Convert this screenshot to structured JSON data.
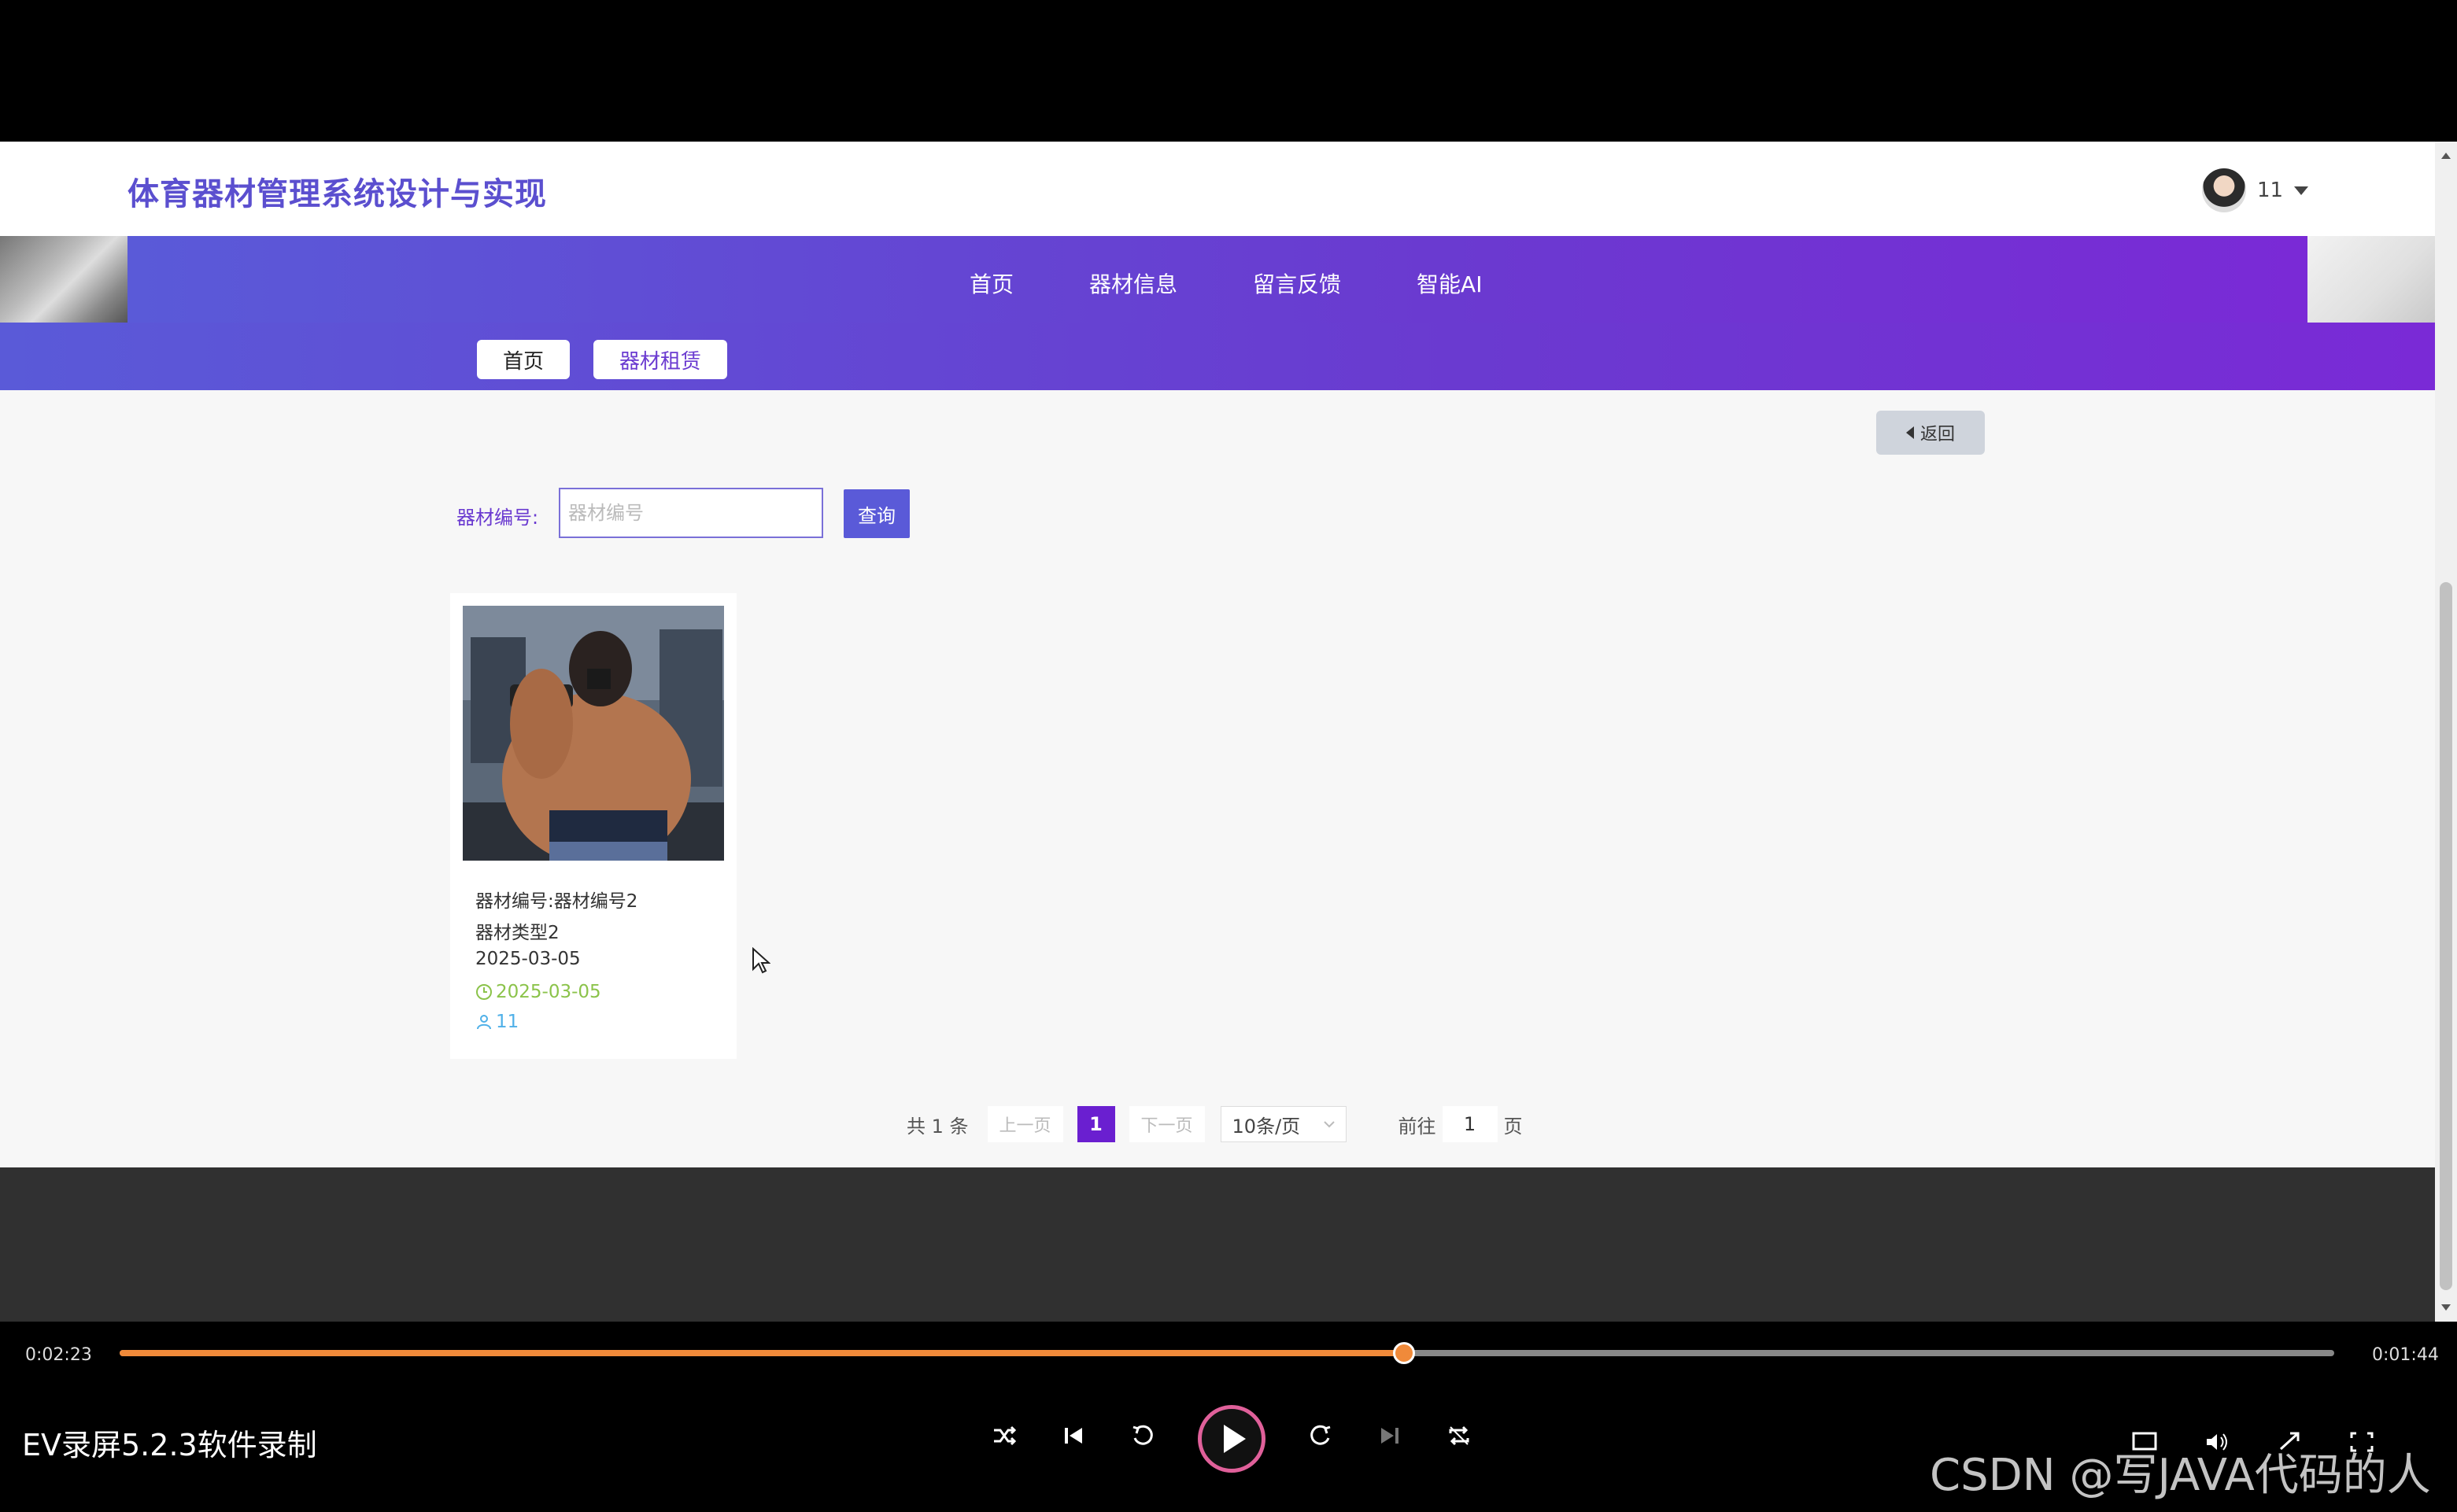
{
  "site": {
    "title": "体育器材管理系统设计与实现"
  },
  "user": {
    "name": "11"
  },
  "nav": {
    "items": [
      "首页",
      "器材信息",
      "留言反馈",
      "智能AI"
    ]
  },
  "breadcrumb": {
    "home": "首页",
    "current": "器材租赁"
  },
  "back": {
    "label": "返回"
  },
  "search": {
    "label": "器材编号:",
    "placeholder": "器材编号",
    "button": "查询"
  },
  "cards": [
    {
      "code": "器材编号:器材编号2",
      "type": "器材类型2",
      "date": "2025-03-05",
      "time": "2025-03-05",
      "user": "11"
    }
  ],
  "pagination": {
    "total": "共 1 条",
    "prev": "上一页",
    "current": "1",
    "next": "下一页",
    "page_size": "10条/页",
    "goto_prefix": "前往",
    "goto_value": "1",
    "goto_suffix": "页"
  },
  "player": {
    "current_time": "0:02:23",
    "total_time": "0:01:44",
    "progress": 0.58,
    "title": "EV录屏5.2.3软件录制",
    "accent": "#f08a3a"
  },
  "watermark": "CSDN @写JAVA代码的人"
}
